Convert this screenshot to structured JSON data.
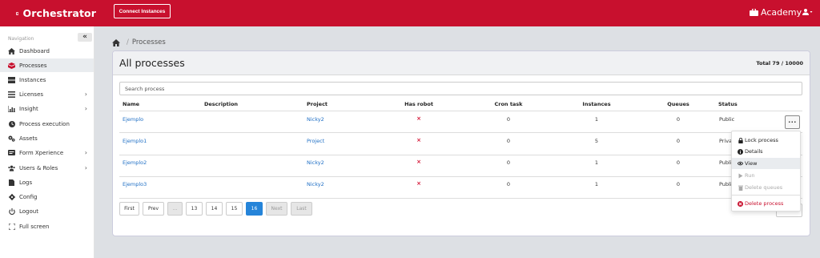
{
  "header": {
    "brand": "Orchestrator",
    "connect_label": "Connect Instances",
    "tenant": "Academy",
    "colors": {
      "brand_red": "#c8102e",
      "link_blue": "#1f6fc5",
      "active_page": "#2584d9"
    }
  },
  "sidebar": {
    "heading": "Navigation",
    "collapse_glyph": "«",
    "items": [
      {
        "label": "Dashboard",
        "icon": "home-icon"
      },
      {
        "label": "Processes",
        "icon": "cubes-icon"
      },
      {
        "label": "Instances",
        "icon": "server-icon"
      },
      {
        "label": "Licenses",
        "icon": "list-icon"
      },
      {
        "label": "Insight",
        "icon": "chart-icon"
      },
      {
        "label": "Process execution",
        "icon": "clock-icon"
      },
      {
        "label": "Assets",
        "icon": "cogs-icon"
      },
      {
        "label": "Form Xperience",
        "icon": "form-icon"
      },
      {
        "label": "Users & Roles",
        "icon": "users-icon"
      },
      {
        "label": "Logs",
        "icon": "file-icon"
      },
      {
        "label": "Config",
        "icon": "gear-icon"
      },
      {
        "label": "Logout",
        "icon": "power-icon"
      },
      {
        "label": "Full screen",
        "icon": "expand-icon"
      }
    ]
  },
  "breadcrumb": {
    "current": "Processes"
  },
  "card": {
    "title": "All processes",
    "total": "Total 79 / 10000",
    "search_placeholder": "Search process"
  },
  "table": {
    "columns": [
      "Name",
      "Description",
      "Project",
      "Has robot",
      "Cron task",
      "Instances",
      "Queues",
      "Status"
    ],
    "rows": [
      {
        "name": "Ejemplo",
        "description": "",
        "project": "Nicky2",
        "has_robot": "×",
        "cron": "0",
        "instances": "1",
        "queues": "0",
        "status": "Public"
      },
      {
        "name": "Ejemplo1",
        "description": "",
        "project": "Project",
        "has_robot": "×",
        "cron": "0",
        "instances": "5",
        "queues": "0",
        "status": "Privat"
      },
      {
        "name": "Ejemplo2",
        "description": "",
        "project": "Nicky2",
        "has_robot": "×",
        "cron": "0",
        "instances": "1",
        "queues": "0",
        "status": "Public"
      },
      {
        "name": "Ejemplo3",
        "description": "",
        "project": "Nicky2",
        "has_robot": "×",
        "cron": "0",
        "instances": "1",
        "queues": "0",
        "status": "Public"
      }
    ],
    "actions_label": "···"
  },
  "pagination": {
    "first": "First",
    "prev": "Prev",
    "ellipsis": "...",
    "pages": [
      "13",
      "14",
      "15",
      "16"
    ],
    "current": "16",
    "next": "Next",
    "last": "Last"
  },
  "dropdown": {
    "lock": "Lock process",
    "details": "Details",
    "view": "View",
    "run": "Run",
    "delete_queues": "Delete queues",
    "delete_process": "Delete process"
  }
}
